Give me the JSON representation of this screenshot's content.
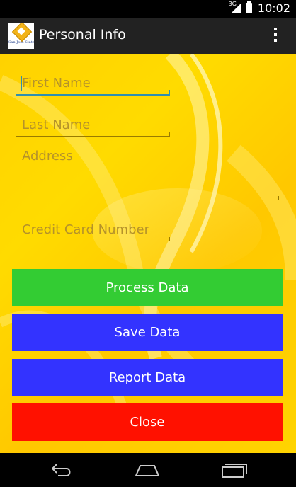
{
  "status_bar": {
    "network": "3G",
    "time": "10:02"
  },
  "action_bar": {
    "logo_text": "San José State",
    "title": "Personal Info"
  },
  "form": {
    "first_name_placeholder": "First Name",
    "last_name_placeholder": "Last Name",
    "address_placeholder": "Address",
    "credit_card_placeholder": "Credit Card Number"
  },
  "buttons": {
    "process": "Process Data",
    "save": "Save Data",
    "report": "Report Data",
    "close": "Close"
  },
  "colors": {
    "process_bg": "#33cc33",
    "save_bg": "#3333ff",
    "report_bg": "#3333ff",
    "close_bg": "#ff1100",
    "background": "#ffd200",
    "action_bar": "#222222"
  },
  "nav_bar": {
    "icons": [
      "back-icon",
      "home-icon",
      "recents-icon"
    ]
  }
}
